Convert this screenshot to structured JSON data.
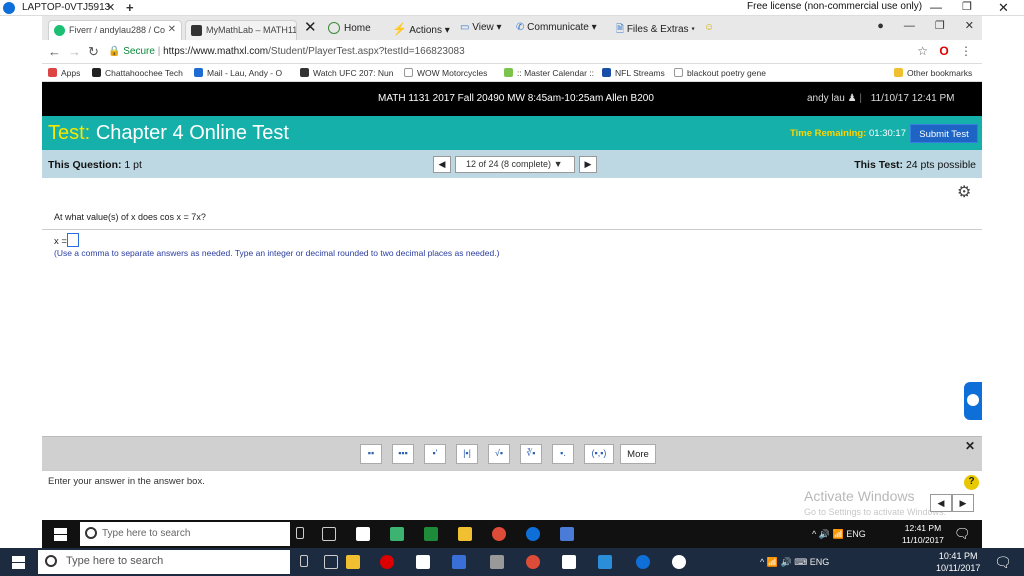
{
  "teamviewer": {
    "title": "LAPTOP-0VTJ5913",
    "license": "Free license (non-commercial use only)"
  },
  "tabs": [
    {
      "label": "Fiverr / andylau288 / Co",
      "icon_color": "#1dbf73"
    },
    {
      "label": "MyMathLab – MATH113",
      "icon_color": "#333333"
    }
  ],
  "mathxl_toolbar": {
    "home": "Home",
    "actions": "Actions",
    "view": "View",
    "communicate": "Communicate",
    "files": "Files & Extras"
  },
  "address": {
    "secure": "Secure",
    "url_host": "https://www.mathxl.com",
    "url_path": "/Student/PlayerTest.aspx?testId=166823083"
  },
  "bookmarks": [
    {
      "label": "Apps",
      "icon_color": "#d44"
    },
    {
      "label": "Chattahoochee Tech",
      "icon_color": "#222"
    },
    {
      "label": "Mail - Lau, Andy - O",
      "icon_color": "#1f6bd4"
    },
    {
      "label": "Watch UFC 207: Nun",
      "icon_color": "#333"
    },
    {
      "label": "WOW Motorcycles",
      "icon_color": "#999"
    },
    {
      "label": ":: Master Calendar ::",
      "icon_color": "#7bc44b"
    },
    {
      "label": "NFL Streams",
      "icon_color": "#1a4da8"
    },
    {
      "label": "blackout poetry gene",
      "icon_color": "#999"
    },
    {
      "label": "Other bookmarks",
      "icon_color": "#f0c030"
    }
  ],
  "course": {
    "title": "MATH 1131 2017 Fall 20490 MW 8:45am-10:25am Allen B200",
    "user": "andy lau",
    "datetime": "11/10/17 12:41 PM"
  },
  "test": {
    "prefix": "Test:",
    "name": "Chapter 4 Online Test",
    "time_label": "Time Remaining:",
    "time_value": "01:30:17",
    "submit": "Submit Test"
  },
  "question_bar": {
    "this_question_label": "This Question:",
    "this_question_value": "1 pt",
    "progress": "12 of 24 (8 complete)",
    "this_test_label": "This Test:",
    "this_test_value": "24 pts possible"
  },
  "question": {
    "text": "At what value(s) of x does cos x = 7x?",
    "answer_label": "x =",
    "instructions": "(Use a comma to separate answers as needed. Type an integer or decimal rounded to two decimal places as needed.)"
  },
  "palette": {
    "buttons": [
      "▪▪",
      "▪▪▪",
      "▪'",
      "|▪|",
      "√▪",
      "∛▪",
      "▪.",
      "(▪,▪)"
    ],
    "more": "More"
  },
  "status": {
    "text": "Enter your answer in the answer box.",
    "help": "?"
  },
  "watermark": {
    "line1": "Activate Windows",
    "line2": "Go to Settings to activate Windows."
  },
  "remote_taskbar": {
    "search": "Type here to search",
    "lang": "ENG",
    "time": "12:41 PM",
    "date": "11/10/2017"
  },
  "local_taskbar": {
    "search": "Type here to search",
    "lang": "ENG",
    "time": "10:41 PM",
    "date": "10/11/2017"
  }
}
